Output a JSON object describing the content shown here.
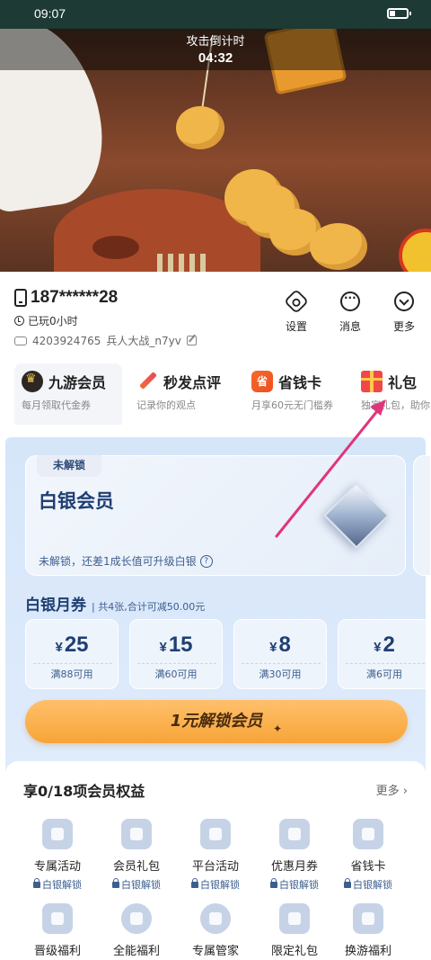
{
  "status_bar": {
    "time": "09:07"
  },
  "countdown": {
    "label": "攻击倒计时",
    "value": "04:32"
  },
  "profile": {
    "phone": "187******28",
    "played": "已玩0小时",
    "player_id": "4203924765",
    "player_name": "兵人大战_n7yv",
    "actions": [
      {
        "label": "设置",
        "icon": "settings-icon"
      },
      {
        "label": "消息",
        "icon": "message-icon"
      },
      {
        "label": "更多",
        "icon": "more-icon"
      }
    ]
  },
  "tabs": [
    {
      "title": "九游会员",
      "sub": "每月领取代金券",
      "icon": "crown-icon"
    },
    {
      "title": "秒发点评",
      "sub": "记录你的观点",
      "icon": "pencil-icon"
    },
    {
      "title": "省钱卡",
      "sub": "月享60元无门槛券",
      "icon": "sheng",
      "icon_text": "省"
    },
    {
      "title": "礼包",
      "sub": "独家礼包，助你",
      "icon": "gift-icon"
    }
  ],
  "silver_card": {
    "badge": "未解锁",
    "title": "白银会员",
    "tip": "未解锁，还差1成长值可升级白银",
    "help": "?"
  },
  "coupons": {
    "title": "白银月券",
    "summary": "| 共4张,合计可减50.00元",
    "currency": "¥",
    "items": [
      {
        "amount": "25",
        "condition": "满88可用"
      },
      {
        "amount": "15",
        "condition": "满60可用"
      },
      {
        "amount": "8",
        "condition": "满30可用"
      },
      {
        "amount": "2",
        "condition": "满6可用"
      }
    ]
  },
  "unlock_button": {
    "label": "1元解锁会员",
    "spark": "✦"
  },
  "benefits": {
    "title": "享0/18项会员权益",
    "more": "更多 ›",
    "row1": [
      {
        "label": "专属活动",
        "lock": "白银解锁"
      },
      {
        "label": "会员礼包",
        "lock": "白银解锁"
      },
      {
        "label": "平台活动",
        "lock": "白银解锁"
      },
      {
        "label": "优惠月券",
        "lock": "白银解锁"
      },
      {
        "label": "省钱卡",
        "lock": "白银解锁"
      }
    ],
    "row2": [
      {
        "label": "晋级福利"
      },
      {
        "label": "全能福利"
      },
      {
        "label": "专属管家"
      },
      {
        "label": "限定礼包"
      },
      {
        "label": "换游福利"
      }
    ]
  },
  "colors": {
    "arrow": "#e0357a",
    "accent_orange": "#f7a437",
    "member_blue": "#1f3f73"
  }
}
